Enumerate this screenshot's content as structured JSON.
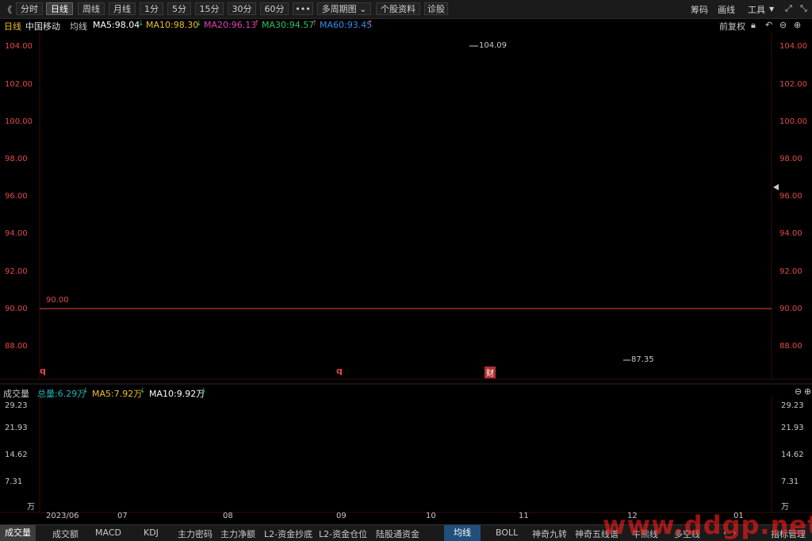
{
  "toolbar": {
    "back": "《",
    "intervals": [
      "分时",
      "日线",
      "周线",
      "月线",
      "1分",
      "5分",
      "15分",
      "30分",
      "60分",
      "•••"
    ],
    "multi": "多周期图",
    "stock_info": "个股资料",
    "diagnose": "诊股",
    "chips": "筹码",
    "draw": "画线",
    "tools": "工具"
  },
  "legend": {
    "period": "日线",
    "name": "中国移动",
    "ma_label": "均线",
    "ma5": "MA5:98.04",
    "ma10": "MA10:98.30",
    "ma20": "MA20:96.13",
    "ma30": "MA30:94.57",
    "ma60": "MA60:93.45",
    "adjust": "前复权"
  },
  "price_axis": {
    "ticks": [
      "104.00",
      "102.00",
      "100.00",
      "98.00",
      "96.00",
      "94.00",
      "92.00",
      "90.00",
      "88.00"
    ]
  },
  "annotations": {
    "high": "104.09",
    "low": "87.35",
    "ref": "90.00",
    "marker_q1": "q",
    "marker_q2": "q",
    "marker_cai": "财"
  },
  "volume": {
    "title": "成交量",
    "total": "总量:6.29万",
    "ma5": "MA5:7.92万",
    "ma10": "MA10:9.92万",
    "ticks": [
      "29.23",
      "21.93",
      "14.62",
      "7.31"
    ],
    "unit": "万"
  },
  "months": [
    "2023/06",
    "07",
    "08",
    "09",
    "10",
    "11",
    "12",
    "01"
  ],
  "bottom_left": [
    "成交量",
    "成交额",
    "MACD",
    "KDJ",
    "主力密码",
    "主力净额",
    "L2-资金抄底",
    "L2-资金仓位",
    "陆股通资金"
  ],
  "bottom_right": [
    "均线",
    "BOLL",
    "神奇九转",
    "神奇五线谱",
    "牛熊线",
    "多空线"
  ],
  "bottom_manage": "指标管理",
  "watermark": "www.ddgp.net",
  "colors": {
    "ma5": "#ffffff",
    "ma10": "#f0c020",
    "ma20": "#e040c0",
    "ma30": "#30c060",
    "ma60": "#3090f0",
    "up": "#e34a4a",
    "down": "#1fb5b5"
  }
}
